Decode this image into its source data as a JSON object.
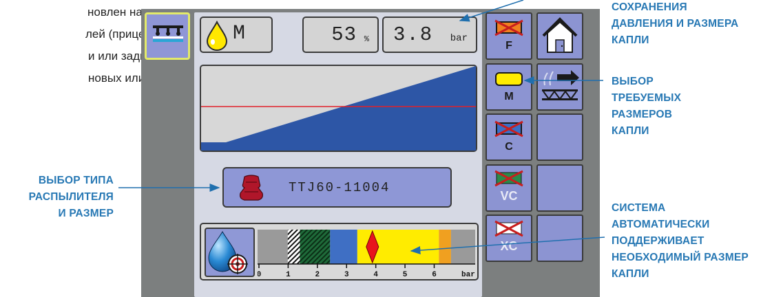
{
  "intro_text": {
    "lines": [
      "новлен на",
      "лей (прицепные,",
      "и или задним",
      "новых или"
    ]
  },
  "callouts": {
    "save": [
      "СОХРАНЕНИЯ",
      "ДАВЛЕНИЯ И РАЗМЕРА",
      "КАПЛИ"
    ],
    "droplet_select": [
      "ВЫБОР",
      "ТРЕБУЕМЫХ",
      "РАЗМЕРОВ",
      "КАПЛИ"
    ],
    "tip_select": [
      "ВЫБОР ТИПА",
      "РАСПЫЛИТЕЛЯ",
      "И РАЗМЕР"
    ],
    "auto_system": [
      "СИСТЕМА",
      "АВТОМАТИЧЕСКИ",
      "ПОДДЕРЖИВАЕТ",
      "НЕОБХОДИМЫЙ РАЗМЕР",
      "КАПЛИ"
    ]
  },
  "display": {
    "droplet_size_letter": "M",
    "percent_value": "53",
    "percent_unit": "%",
    "pressure_value": "3.8",
    "pressure_unit": "bar",
    "tip_name": "TTJ60-11004",
    "scale": {
      "ticks": [
        "0",
        "1",
        "2",
        "3",
        "4",
        "5",
        "6",
        "bar"
      ],
      "bands": [
        {
          "from": 0,
          "to": 1.0,
          "color": "#9a9a9a"
        },
        {
          "from": 1.0,
          "to": 1.4,
          "color": "#ffffff",
          "pattern": "hatch-black"
        },
        {
          "from": 1.4,
          "to": 2.4,
          "color": "#1f6b3a",
          "pattern": "hatch-green"
        },
        {
          "from": 2.4,
          "to": 3.3,
          "color": "#3f6fc4"
        },
        {
          "from": 3.3,
          "to": 6.0,
          "color": "#ffec00"
        },
        {
          "from": 6.0,
          "to": 6.4,
          "color": "#f0a020"
        },
        {
          "from": 6.4,
          "to": 7.2,
          "color": "#9a9a9a"
        }
      ],
      "marker_value": 3.8
    },
    "graph": {
      "fill_color": "#2d56a6",
      "line_color": "#e0202a",
      "background": "#d7d7d7"
    }
  },
  "buttons": {
    "droplets": [
      {
        "letter": "F",
        "selected": false,
        "crossed": true,
        "fill": "#f08020"
      },
      {
        "letter": "M",
        "selected": true,
        "crossed": false,
        "fill": "#ffec00"
      },
      {
        "letter": "C",
        "selected": false,
        "crossed": true,
        "fill": "#3b6fc6"
      },
      {
        "letter": "VC",
        "selected": false,
        "crossed": true,
        "fill": "#2a8a4a"
      },
      {
        "letter": "XC",
        "selected": false,
        "crossed": true,
        "fill": "#ffffff"
      }
    ],
    "home_icon": "home-icon",
    "boom_icon": "boom-arrow-icon"
  }
}
